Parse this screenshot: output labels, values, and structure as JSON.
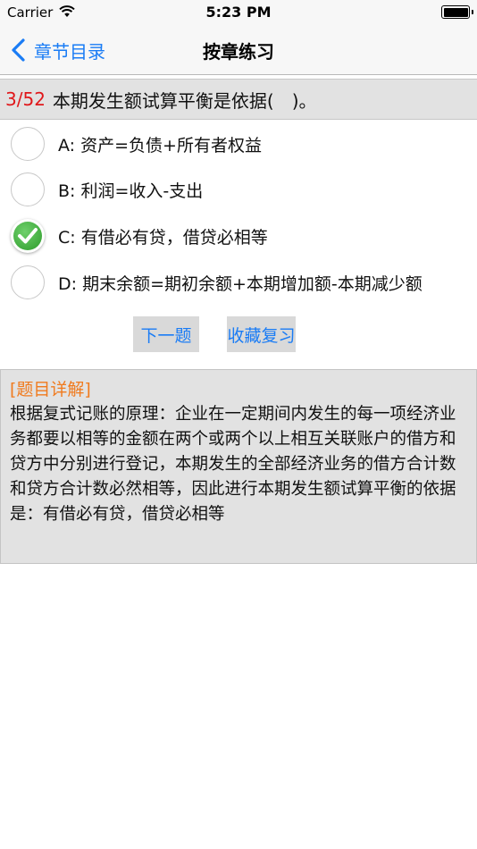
{
  "status_bar": {
    "carrier": "Carrier",
    "time": "5:23 PM"
  },
  "nav": {
    "back_label": "章节目录",
    "title": "按章练习"
  },
  "question": {
    "number": "3/52",
    "text": "本期发生额试算平衡是依据(　)。"
  },
  "options": [
    {
      "text": "A: 资产=负债+所有者权益",
      "selected": false
    },
    {
      "text": "B: 利润=收入-支出",
      "selected": false
    },
    {
      "text": "C: 有借必有贷，借贷必相等",
      "selected": true
    },
    {
      "text": "D: 期末余额=期初余额+本期增加额-本期减少额",
      "selected": false
    }
  ],
  "buttons": {
    "next_label": "下一题",
    "favorite_label": "收藏复习"
  },
  "explanation": {
    "heading": "[题目详解]",
    "body": "根据复式记账的原理：企业在一定期间内发生的每一项经济业务都要以相等的金额在两个或两个以上相互关联账户的借方和贷方中分别进行登记，本期发生的全部经济业务的借方合计数和贷方合计数必然相等，因此进行本期发生额试算平衡的依据是：有借必有贷，借贷必相等"
  },
  "colors": {
    "accent": "#1a7cf5",
    "question_number": "#e0181b",
    "explanation_heading": "#f07a1d",
    "check_green": "#3aaa35"
  },
  "icons": {
    "back": "chevron-left-icon",
    "wifi": "wifi-icon",
    "battery": "battery-icon",
    "check": "checkmark-icon"
  }
}
